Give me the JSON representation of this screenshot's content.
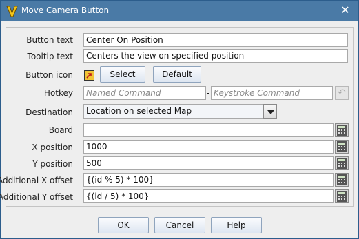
{
  "window": {
    "title": "Move Camera Button",
    "close_glyph": "✕"
  },
  "form": {
    "button_text": {
      "label": "Button text",
      "value": "Center On Position"
    },
    "tooltip_text": {
      "label": "Tooltip text",
      "value": "Centers the view on specified position"
    },
    "button_icon": {
      "label": "Button icon",
      "select_label": "Select",
      "default_label": "Default"
    },
    "hotkey": {
      "label": "Hotkey",
      "named_placeholder": "Named Command",
      "separator": "-",
      "keystroke_placeholder": "Keystroke Command",
      "undo_glyph": "↶"
    },
    "destination": {
      "label": "Destination",
      "value": "Location on selected Map"
    },
    "board": {
      "label": "Board",
      "value": ""
    },
    "x_position": {
      "label": "X position",
      "value": "1000"
    },
    "y_position": {
      "label": "Y position",
      "value": "500"
    },
    "additional_x_offset": {
      "label": "Additional X offset",
      "value": "{(id % 5) * 100}"
    },
    "additional_y_offset": {
      "label": "Additional Y offset",
      "value": "{(id / 5) * 100}"
    }
  },
  "footer": {
    "ok_label": "OK",
    "cancel_label": "Cancel",
    "help_label": "Help"
  },
  "icons": {
    "app": "vassal-v-icon",
    "calculator": "calculator-icon",
    "swatch": "button-icon-preview",
    "undo": "undo-icon",
    "dropdown": "chevron-down-icon",
    "close": "close-icon"
  },
  "colors": {
    "titlebar": "#4a7aa6",
    "button_face": "#dde6f1",
    "field_border": "#a9a9a9"
  }
}
